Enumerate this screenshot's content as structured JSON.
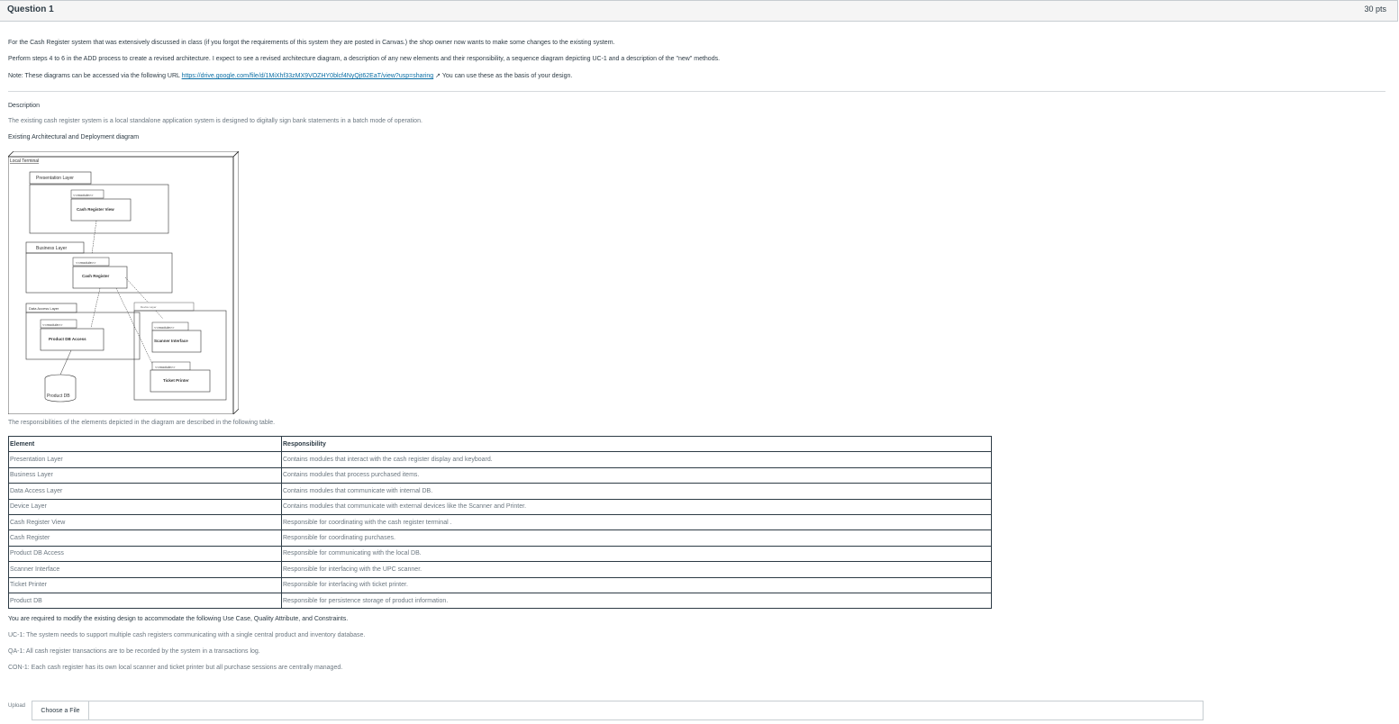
{
  "question": {
    "title": "Question 1",
    "points": "30 pts"
  },
  "intro": {
    "p1": "For the Cash Register system that was extensively discussed in class (if you forgot the requirements of this system they are posted in Canvas.) the shop owner now wants to make some changes to the existing system.",
    "p2": "Perform steps 4 to 6 in the ADD process to create a revised architecture. I expect to see a revised architecture diagram, a description of any new elements and their responsibility, a sequence diagram depicting UC-1 and a description of the \"new\" methods.",
    "p3_prefix": "Note: These diagrams can be accessed via the following URL ",
    "p3_link": "https://drive.google.com/file/d/1MiXhf33zMX9VOZHY0blcf4NyQjt62EaT/view?usp=sharing",
    "p3_icon": "external-link-icon",
    "p3_suffix": " You can use these as the basis of your design."
  },
  "description": {
    "heading": "Description",
    "text": "The existing cash register system is a local standalone application system is designed to digitally sign bank statements in a batch mode of operation.",
    "diagram_heading": "Existing Architectural and Deployment diagram"
  },
  "diagram": {
    "node": "Local Terminal",
    "presentation_layer": "Presentation Layer",
    "business_layer": "Business Layer",
    "data_access_layer": "Data Access Layer",
    "device_layer": "Device Layer",
    "module_stereotype": "<<module>>",
    "cash_register_view": "Cash Register View",
    "cash_register": "Cash Register",
    "product_db_access": "Product DB Access",
    "scanner_interface": "Scanner Interface",
    "ticket_printer": "Ticket Printer",
    "product_db": "Product DB"
  },
  "table_intro": "The responsibilities of the elements depicted in the diagram are described in the following table.",
  "table": {
    "headers": [
      "Element",
      "Responsibility"
    ],
    "rows": [
      [
        "Presentation Layer",
        "Contains modules that interact with the cash register display and keyboard."
      ],
      [
        "Business Layer",
        "Contains modules that process purchased items."
      ],
      [
        "Data Access Layer",
        "Contains modules that communicate with internal DB."
      ],
      [
        "Device Layer",
        "Contains modules that communicate with external devices like the Scanner and Printer."
      ],
      [
        "Cash Register View",
        "Responsible for coordinating with the cash register terminal ."
      ],
      [
        "Cash Register",
        "Responsible for coordinating purchases."
      ],
      [
        "Product DB Access",
        "Responsible for communicating with the local DB."
      ],
      [
        "Scanner Interface",
        "Responsible for interfacing with the UPC scanner."
      ],
      [
        "Ticket Printer",
        "Responsible for interfacing with ticket printer."
      ],
      [
        "Product DB",
        "Responsible for persistence storage of product information."
      ]
    ]
  },
  "requirements": {
    "heading": "You are required to modify the existing design to accommodate the following Use Case, Quality Attribute, and Constraints.",
    "uc": "UC-1: The system needs to support multiple cash registers communicating with a single central product and inventory database.",
    "qa": "QA-1: All cash register transactions are to be recorded by the system in a transactions log.",
    "con": "CON-1: Each cash register has its own local scanner and ticket printer but all purchase sessions are centrally managed."
  },
  "upload": {
    "label": "Upload",
    "button": "Choose a File"
  }
}
